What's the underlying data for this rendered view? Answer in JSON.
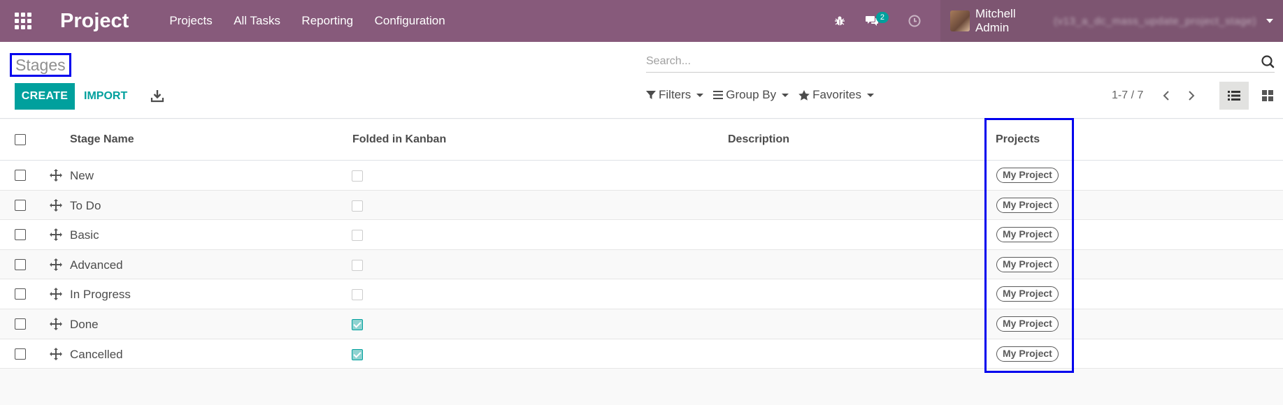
{
  "navbar": {
    "app_title": "Project",
    "menu": [
      "Projects",
      "All Tasks",
      "Reporting",
      "Configuration"
    ],
    "messages_count": "2",
    "user_name": "Mitchell Admin",
    "user_db": "(v13_a_dc_mass_update_project_stage)",
    "icons": [
      "apps-grid-icon",
      "bug-icon",
      "chat-icon",
      "clock-icon"
    ]
  },
  "control": {
    "title": "Stages",
    "search_placeholder": "Search...",
    "create_label": "CREATE",
    "import_label": "IMPORT",
    "filters_label": "Filters",
    "groupby_label": "Group By",
    "favorites_label": "Favorites",
    "pager": "1-7 / 7"
  },
  "table": {
    "columns": [
      "Stage Name",
      "Folded in Kanban",
      "Description",
      "Projects"
    ],
    "rows": [
      {
        "name": "New",
        "folded": false,
        "project": "My Project"
      },
      {
        "name": "To Do",
        "folded": false,
        "project": "My Project"
      },
      {
        "name": "Basic",
        "folded": false,
        "project": "My Project"
      },
      {
        "name": "Advanced",
        "folded": false,
        "project": "My Project"
      },
      {
        "name": "In Progress",
        "folded": false,
        "project": "My Project"
      },
      {
        "name": "Done",
        "folded": true,
        "project": "My Project"
      },
      {
        "name": "Cancelled",
        "folded": true,
        "project": "My Project"
      }
    ]
  },
  "colors": {
    "navbar": "#875a7b",
    "accent": "#00a09d",
    "highlight": "#0000ee"
  }
}
